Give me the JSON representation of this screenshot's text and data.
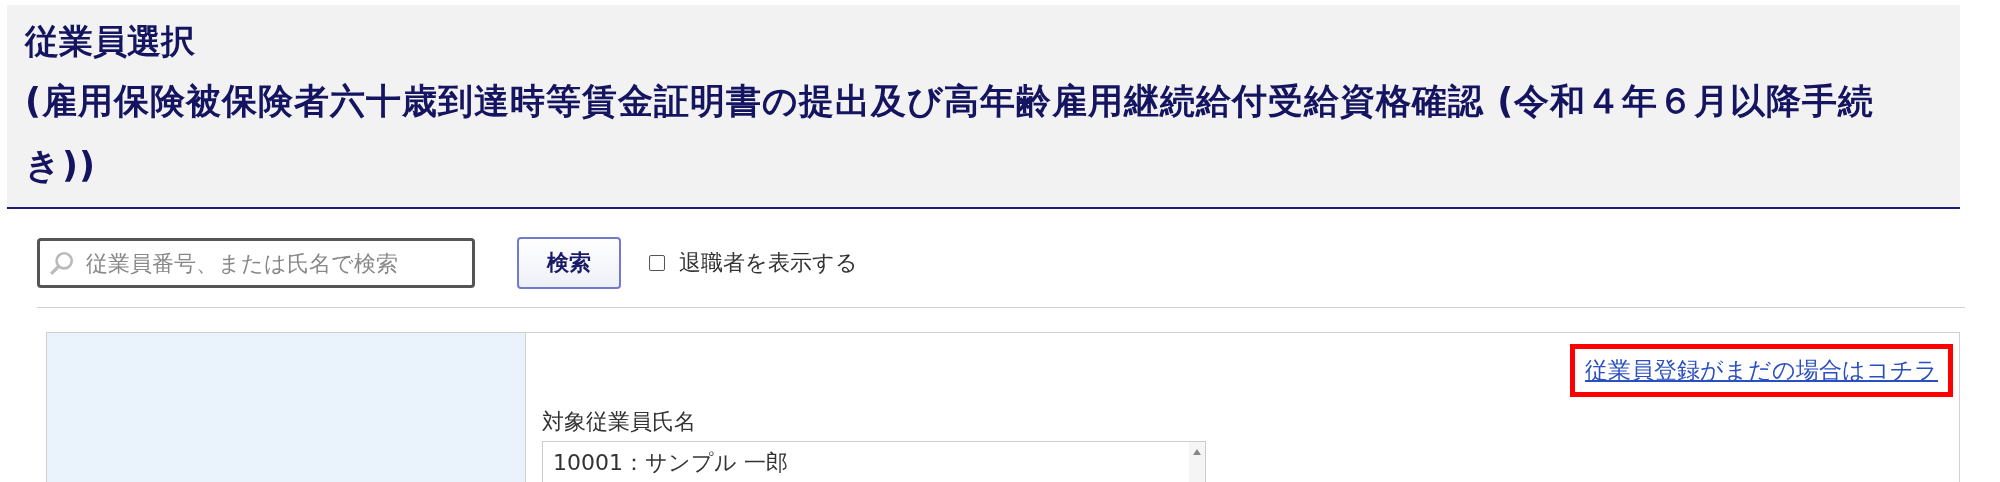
{
  "header": {
    "title": "従業員選択",
    "subtitle": "(雇用保険被保険者六十歳到達時等賃金証明書の提出及び高年齢雇用継続給付受給資格確認 (令和４年６月以降手続き))"
  },
  "search": {
    "placeholder": "従業員番号、または氏名で検索",
    "button": "検索",
    "show_retired": {
      "label": "退職者を表示する",
      "checked": false
    }
  },
  "form": {
    "register_link": {
      "label": "従業員登録がまだの場合はコチラ",
      "highlighted": true
    },
    "employee_label": "対象従業員氏名",
    "employees": [
      {
        "label": "10001：サンプル 一郎",
        "selected": false
      }
    ]
  }
}
